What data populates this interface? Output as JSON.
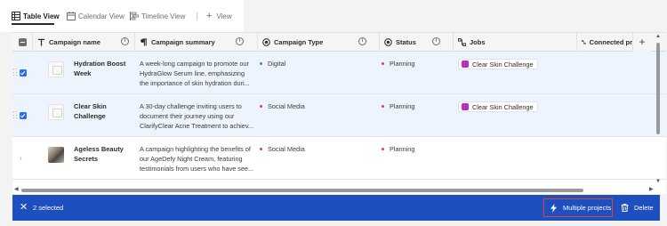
{
  "views": {
    "tabs": [
      {
        "label": "Table View",
        "icon": "table-icon",
        "active": true
      },
      {
        "label": "Calendar View",
        "icon": "calendar-icon"
      },
      {
        "label": "Timeline View",
        "icon": "timeline-icon"
      }
    ],
    "add_view_label": "View"
  },
  "table": {
    "columns": [
      {
        "label": "Campaign name",
        "icon": "text-type-icon"
      },
      {
        "label": "Campaign summary",
        "icon": "paragraph-icon"
      },
      {
        "label": "Campaign Type",
        "icon": "single-select-icon"
      },
      {
        "label": "Status",
        "icon": "single-select-icon"
      },
      {
        "label": "Jobs",
        "icon": "connection-icon"
      },
      {
        "label": "Connected pr",
        "icon": "connection-icon"
      }
    ],
    "rows": [
      {
        "selected": true,
        "name": "Hydration Boost Week",
        "summary": "A week-long campaign to promote our HydraGlow Serum line, emphasizing the importance of skin hydration duri...",
        "type": "Digital",
        "status": "Planning",
        "job": "Clear Skin Challenge"
      },
      {
        "selected": true,
        "name": "Clear Skin Challenge",
        "summary": "A 30-day challenge inviting users to document their journey using our ClarifyClear Acne Treatment to achiev...",
        "type": "Social Media",
        "status": "Planning",
        "job": "Clear Skin Challenge"
      },
      {
        "selected": false,
        "name": "Ageless Beauty Secrets",
        "summary": "A campaign highlighting the benefits of our AgeDefy Night Cream, featuring testimonials from users who have see...",
        "type": "Social Media",
        "status": "Planning",
        "job": ""
      }
    ],
    "colors": {
      "type_dot": "#2d9d78",
      "social_dot": "#d83790",
      "status_dot": "#d83790",
      "selected_row": "#eef4fd",
      "checkbox": "#2b6fe3"
    }
  },
  "actionbar": {
    "selected_text": "2 selected",
    "multi_label": "Multiple projects",
    "delete_label": "Delete",
    "background": "#1d4fbf"
  }
}
